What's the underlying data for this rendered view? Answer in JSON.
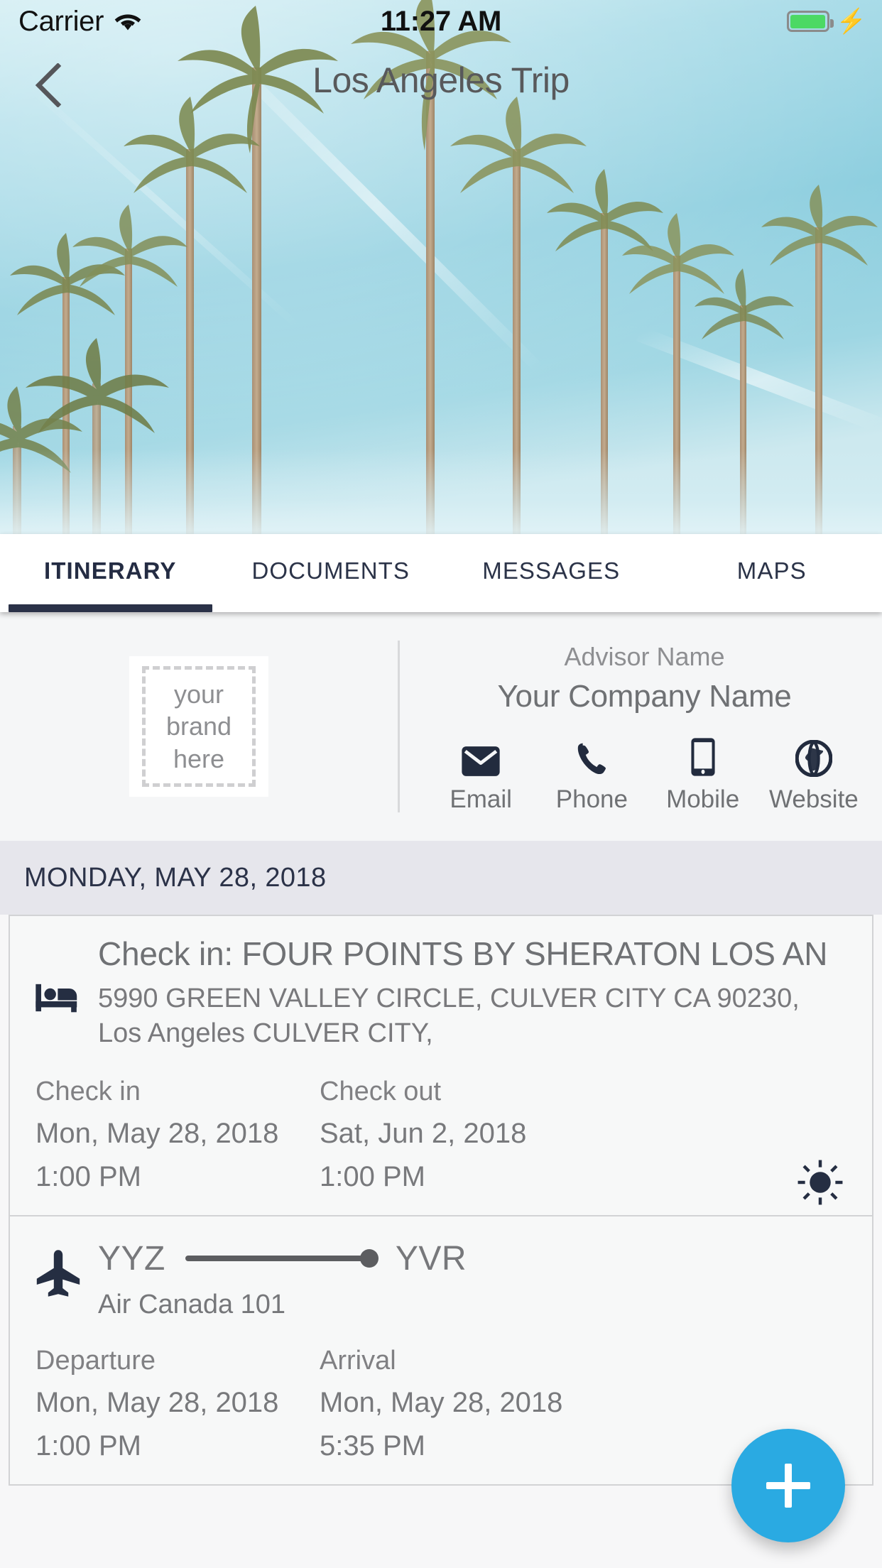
{
  "status_bar": {
    "carrier": "Carrier",
    "wifi_icon": "wifi-icon",
    "time": "11:27 AM",
    "battery_icon": "battery-icon",
    "charging_icon": "charging-bolt-icon",
    "battery_color": "#4cd964"
  },
  "nav": {
    "back_icon": "chevron-left-icon",
    "title": "Los Angeles Trip",
    "title_color": "#58595b"
  },
  "hero": {
    "image_name": "palm-trees-hero-photo",
    "sky_color": "#8ecede"
  },
  "tabs": [
    {
      "label": "ITINERARY",
      "active": true
    },
    {
      "label": "DOCUMENTS",
      "active": false
    },
    {
      "label": "MESSAGES",
      "active": false
    },
    {
      "label": "MAPS",
      "active": false
    }
  ],
  "tabs_active_color": "#2b3248",
  "advisor": {
    "brand_placeholder_lines": [
      "your",
      "brand",
      "here"
    ],
    "advisor_label": "Advisor Name",
    "company_name": "Your Company Name",
    "contacts": [
      {
        "label": "Email",
        "icon": "envelope-icon"
      },
      {
        "label": "Phone",
        "icon": "phone-handset-icon"
      },
      {
        "label": "Mobile",
        "icon": "mobile-phone-icon"
      },
      {
        "label": "Website",
        "icon": "globe-icon"
      }
    ],
    "icon_color": "#222b3e"
  },
  "date_header": "MONDAY, MAY 28, 2018",
  "hotel_card": {
    "icon": "bed-icon",
    "title": "Check in: FOUR POINTS BY SHERATON LOS AN",
    "address": "5990 GREEN VALLEY CIRCLE, CULVER CITY CA 90230, Los Angeles CULVER CITY,",
    "check_in_label": "Check in",
    "check_in_date": "Mon, May 28, 2018",
    "check_in_time": "1:00 PM",
    "check_out_label": "Check out",
    "check_out_date": "Sat, Jun 2, 2018",
    "check_out_time": "1:00 PM",
    "weather_icon": "sun-icon"
  },
  "flight_card": {
    "icon": "airplane-icon",
    "origin": "YYZ",
    "destination": "YVR",
    "airline": "Air Canada 101",
    "departure_label": "Departure",
    "departure_date": "Mon, May 28, 2018",
    "departure_time": "1:00 PM",
    "arrival_label": "Arrival",
    "arrival_date": "Mon, May 28, 2018",
    "arrival_time": "5:35 PM"
  },
  "fab": {
    "icon": "plus-icon",
    "color": "#2aaae2"
  }
}
